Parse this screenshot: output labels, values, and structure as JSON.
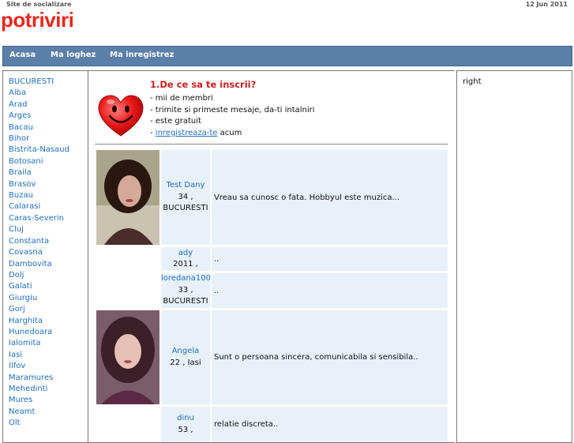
{
  "header": {
    "tagline": "Site de socializare",
    "date": "12 Jun 2011",
    "logo": "potriviri"
  },
  "nav": {
    "items": [
      "Acasa",
      "Ma loghez",
      "Ma inregistrez"
    ]
  },
  "sidebar": {
    "counties": [
      "BUCURESTI",
      "Alba",
      "Arad",
      "Arges",
      "Bacau",
      "Bihor",
      "Bistrita-Nasaud",
      "Botosani",
      "Braila",
      "Brasov",
      "Buzau",
      "Calarasi",
      "Caras-Severin",
      "Cluj",
      "Constanta",
      "Covasna",
      "Dambovita",
      "Dolj",
      "Galati",
      "Giurgiu",
      "Gorj",
      "Harghita",
      "Hunedoara",
      "Ialomita",
      "Iasi",
      "Ilfov",
      "Maramures",
      "Mehedinti",
      "Mures",
      "Neamt",
      "Olt"
    ]
  },
  "intro": {
    "title": "1.De ce sa te inscrii?",
    "bullets": [
      "- mii de membri",
      "- trimite si primeste mesaje, da-ti intalniri",
      "- este gratuit"
    ],
    "register_prefix": "- ",
    "register_link": "inregistreaza-te",
    "register_suffix": " acum"
  },
  "members": [
    {
      "name": "Test Dany",
      "age_line": "34 ,",
      "city": "BUCURESTI",
      "desc": "Vreau sa cunosc o fata. Hobbyul este muzica..."
    },
    {
      "name": "ady",
      "age_line": "2011 ,",
      "city": "",
      "desc": ".."
    },
    {
      "name": "loredana100",
      "age_line": "33 ,",
      "city": "BUCURESTI",
      "desc": ".."
    },
    {
      "name": "Angela",
      "age_line": "22 , Iasi",
      "city": "",
      "desc": "Sunt o persoana sincera, comunicabila si sensibila.."
    },
    {
      "name": "dinu",
      "age_line": "53 ,",
      "city": "",
      "desc": "relatie discreta.."
    }
  ],
  "right_panel": {
    "text": "right"
  },
  "colors": {
    "logo": "#e8281e",
    "nav_bg": "#5a7fa8",
    "link": "#1f6fc2",
    "row_bg": "#e8f1fa",
    "title_red": "#cc1f1f"
  }
}
